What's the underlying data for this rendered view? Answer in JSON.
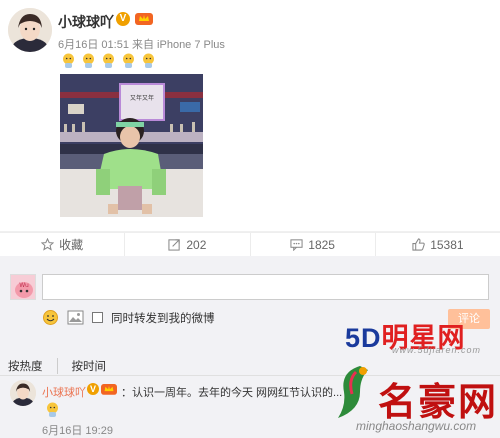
{
  "post": {
    "username": "小球球吖",
    "verified_mark": "V",
    "meta": "6月16日 01:51 来自 iPhone 7 Plus",
    "emoji_icons": [
      "face-icon",
      "face-icon",
      "face-icon",
      "face-icon",
      "face-icon"
    ],
    "image_sign_text": "又年又年"
  },
  "actions": [
    {
      "icon": "star-icon",
      "label": "收藏"
    },
    {
      "icon": "share-icon",
      "label": "202"
    },
    {
      "icon": "comment-icon",
      "label": "1825"
    },
    {
      "icon": "thumbs-up-icon",
      "label": "15381"
    }
  ],
  "comment_box": {
    "input_value": "",
    "forward_label": "同时转发到我的微博",
    "post_button": "评论"
  },
  "sort": {
    "hot": "按热度",
    "time": "按时间"
  },
  "comment": {
    "username": "小球球吖",
    "verified_mark": "V",
    "text": "：认识一周年。去年的今天 网网红节认识的...",
    "time": "6月16日 19:29"
  },
  "watermarks": {
    "brand1_prefix": "5D",
    "brand1_name": "明星网",
    "brand1_url": "www.5djiaren.com",
    "brand2_name": "名豪网",
    "brand2_url": "minghaoshangwu.com"
  },
  "colors": {
    "accent": "#eb7350",
    "verified": "#f0a000",
    "watermark_red": "#e02020"
  }
}
